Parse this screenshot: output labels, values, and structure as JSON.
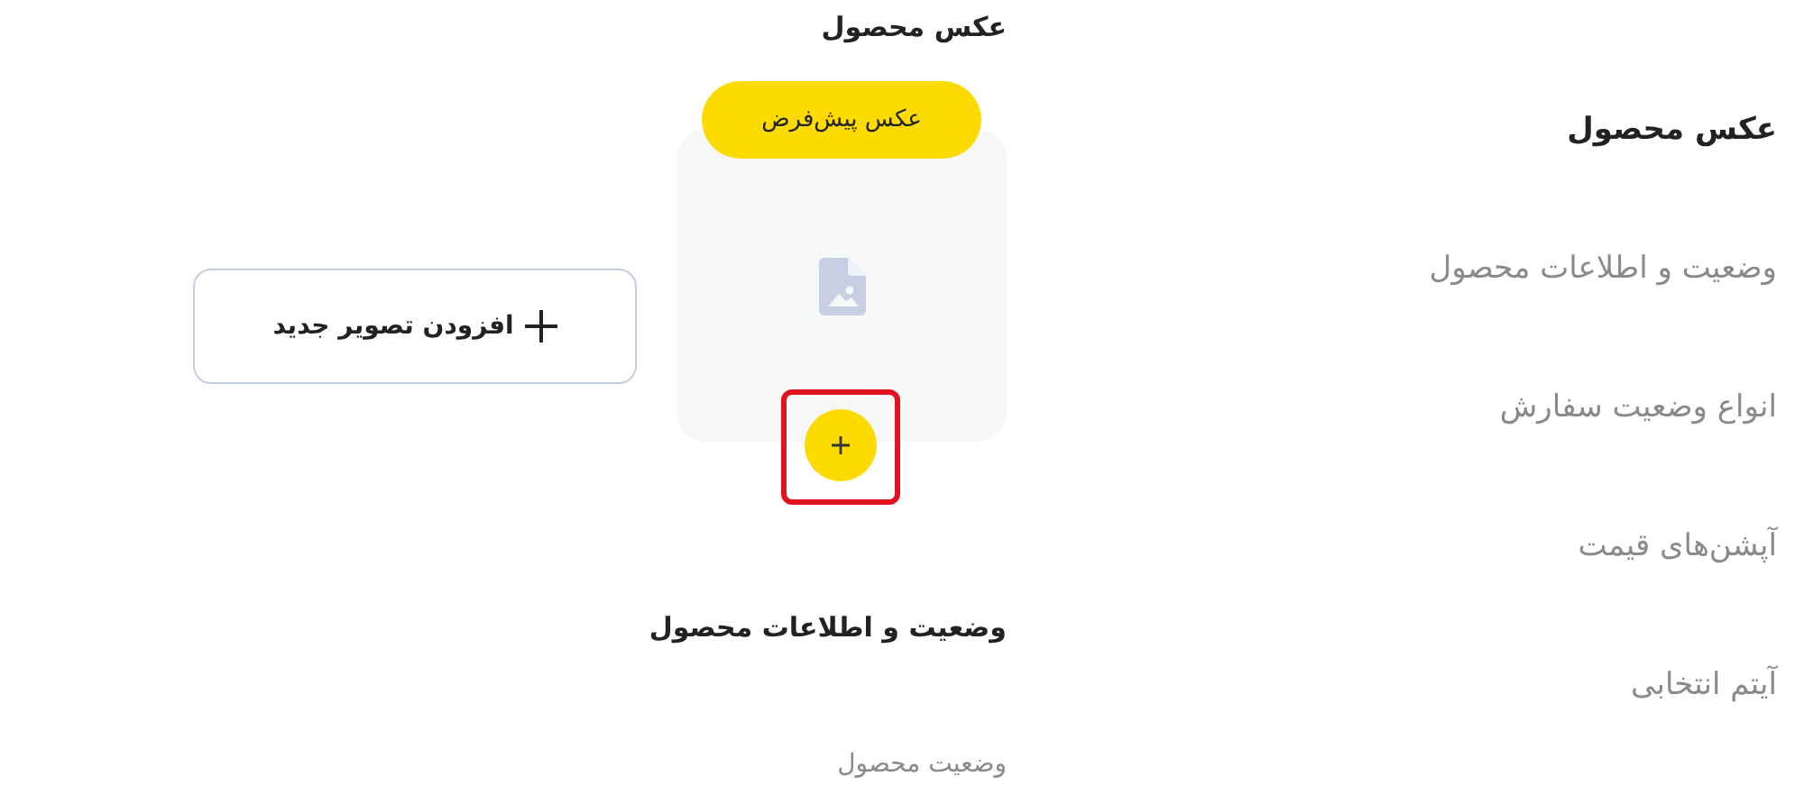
{
  "sidebar": {
    "items": [
      {
        "label": "عکس محصول",
        "selected": true
      },
      {
        "label": "وضعیت و اطلاعات محصول",
        "selected": false
      },
      {
        "label": "انواع وضعیت سفارش",
        "selected": false
      },
      {
        "label": "آپشن‌های قیمت",
        "selected": false
      },
      {
        "label": "آیتم انتخابی",
        "selected": false
      }
    ]
  },
  "product_photo": {
    "title": "عکس محصول",
    "image_card": {
      "badge": "عکس پیش‌فرض",
      "highlighted": true
    },
    "add_button": {
      "label": "افزودن تصویر جدید"
    }
  },
  "status_section": {
    "title": "وضعیت و اطلاعات محصول",
    "fields": [
      {
        "label": "وضعیت محصول"
      }
    ]
  }
}
